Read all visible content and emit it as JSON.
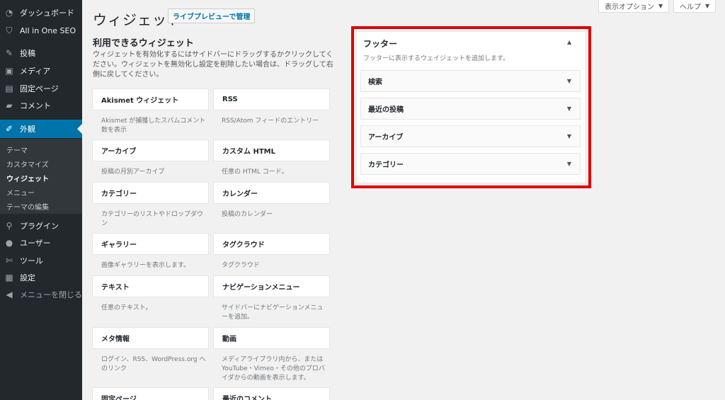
{
  "sidebar": {
    "top_items": [
      {
        "label": "ダッシュボード",
        "icon": "dashboard-icon"
      },
      {
        "label": "All in One SEO",
        "icon": "shield-icon"
      },
      {
        "label": "投稿",
        "icon": "pin-icon"
      },
      {
        "label": "メディア",
        "icon": "media-icon"
      },
      {
        "label": "固定ページ",
        "icon": "page-icon"
      },
      {
        "label": "コメント",
        "icon": "comment-icon"
      },
      {
        "label": "外観",
        "icon": "paintbrush-icon"
      }
    ],
    "submenu": [
      "テーマ",
      "カスタマイズ",
      "ウィジェット",
      "メニュー",
      "テーマの編集"
    ],
    "bottom_items": [
      {
        "label": "プラグイン",
        "icon": "plugin-icon"
      },
      {
        "label": "ユーザー",
        "icon": "user-icon"
      },
      {
        "label": "ツール",
        "icon": "wrench-icon"
      },
      {
        "label": "設定",
        "icon": "settings-icon"
      },
      {
        "label": "メニューを閉じる",
        "icon": "collapse-icon"
      }
    ]
  },
  "header": {
    "title": "ウィジェット",
    "live_preview": "ライブプレビューで管理",
    "screen_options": "表示オプション",
    "help": "ヘルプ"
  },
  "available": {
    "title": "利用できるウィジェット",
    "description": "ウィジェットを有効化するにはサイドバーにドラッグするかクリックしてください。ウィジェットを無効化し設定を削除したい場合は、ドラッグして右側に戻してください。",
    "widgets": [
      {
        "name": "Akismet ウィジェット",
        "desc": "Akismet が捕獲したスパムコメント数を表示"
      },
      {
        "name": "RSS",
        "desc": "RSS/Atom フィードのエントリー"
      },
      {
        "name": "アーカイブ",
        "desc": "投稿の月別アーカイブ"
      },
      {
        "name": "カスタム HTML",
        "desc": "任意の HTML コード。"
      },
      {
        "name": "カテゴリー",
        "desc": "カテゴリーのリストやドロップダウン"
      },
      {
        "name": "カレンダー",
        "desc": "投稿のカレンダー"
      },
      {
        "name": "ギャラリー",
        "desc": "画像ギャラリーを表示します。"
      },
      {
        "name": "タグクラウド",
        "desc": "タグクラウド"
      },
      {
        "name": "テキスト",
        "desc": "任意のテキスト。"
      },
      {
        "name": "ナビゲーションメニュー",
        "desc": "サイドバーにナビゲーションメニューを追加。"
      },
      {
        "name": "メタ情報",
        "desc": "ログイン、RSS、WordPress.org へのリンク"
      },
      {
        "name": "動画",
        "desc": "メディアライブラリ内から、または YouTube・Vimeo・その他のプロバイダからの動画を表示します。"
      },
      {
        "name": "固定ページ",
        "desc": ""
      },
      {
        "name": "最近のコメント",
        "desc": ""
      }
    ]
  },
  "footer_area": {
    "title": "フッター",
    "description": "フッターに表示するウェイジェットを追加します。",
    "widgets": [
      "検索",
      "最近の投稿",
      "アーカイブ",
      "カテゴリー"
    ]
  },
  "colors": {
    "sidebar_bg": "#23282d",
    "active_menu": "#0073aa",
    "highlight_border": "#e00000"
  }
}
